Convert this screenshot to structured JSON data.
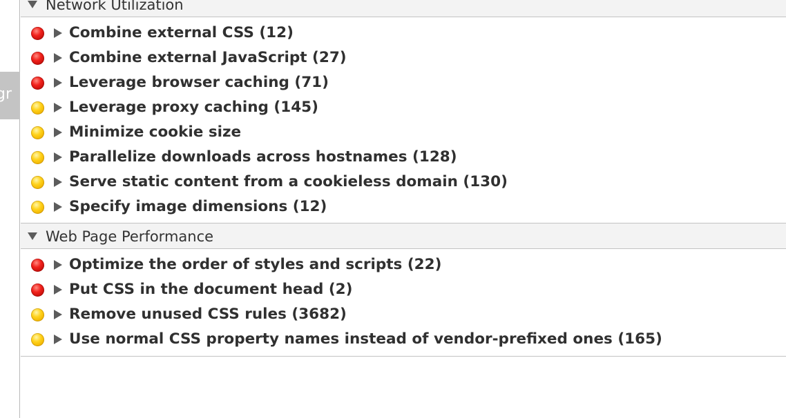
{
  "side_tab": {
    "label": "gr"
  },
  "sections": [
    {
      "title": "Network Utilization",
      "rules": [
        {
          "severity": "red",
          "label": "Combine external CSS (12)"
        },
        {
          "severity": "red",
          "label": "Combine external JavaScript (27)"
        },
        {
          "severity": "red",
          "label": "Leverage browser caching (71)"
        },
        {
          "severity": "yellow",
          "label": "Leverage proxy caching (145)"
        },
        {
          "severity": "yellow",
          "label": "Minimize cookie size"
        },
        {
          "severity": "yellow",
          "label": "Parallelize downloads across hostnames (128)"
        },
        {
          "severity": "yellow",
          "label": "Serve static content from a cookieless domain (130)"
        },
        {
          "severity": "yellow",
          "label": "Specify image dimensions (12)"
        }
      ]
    },
    {
      "title": "Web Page Performance",
      "rules": [
        {
          "severity": "red",
          "label": "Optimize the order of styles and scripts (22)"
        },
        {
          "severity": "red",
          "label": "Put CSS in the document head (2)"
        },
        {
          "severity": "yellow",
          "label": "Remove unused CSS rules (3682)"
        },
        {
          "severity": "yellow",
          "label": "Use normal CSS property names instead of vendor-prefixed ones (165)"
        }
      ]
    }
  ],
  "icons": {
    "section_toggle": "triangle-down-icon",
    "rule_expand": "triangle-right-icon",
    "severity_red": "red-circle-icon",
    "severity_yellow": "yellow-circle-icon"
  },
  "colors": {
    "severity_red": "#e8201a",
    "severity_yellow": "#fcc90d",
    "header_bg": "#f3f3f3",
    "side_tab_bg": "#c4c4c4"
  }
}
